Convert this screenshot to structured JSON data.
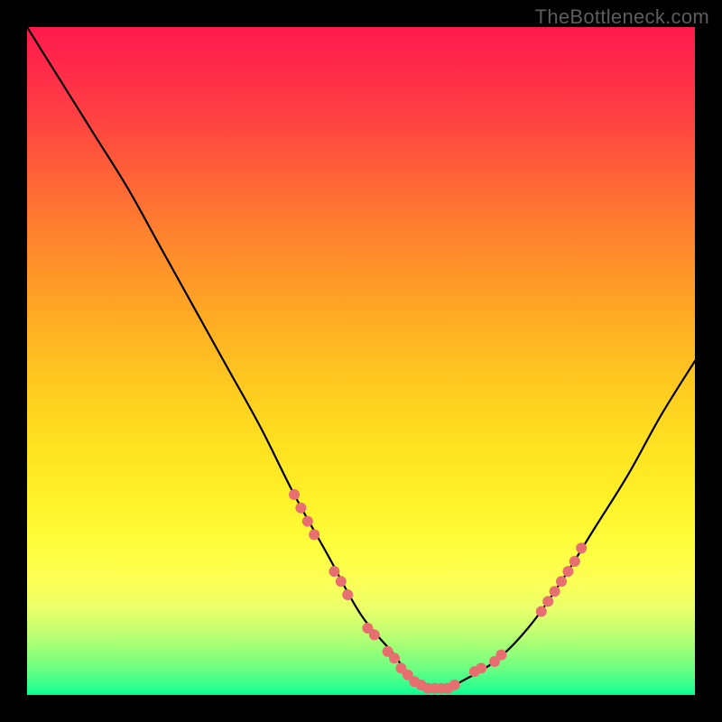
{
  "watermark": "TheBottleneck.com",
  "colors": {
    "curve_stroke": "#000000",
    "marker_fill": "#e86f6f",
    "marker_stroke": "#e86f6f"
  },
  "chart_data": {
    "type": "line",
    "title": "",
    "xlabel": "",
    "ylabel": "",
    "xlim": [
      0,
      100
    ],
    "ylim": [
      0,
      100
    ],
    "grid": false,
    "legend": false,
    "series": [
      {
        "name": "bottleneck-curve",
        "x": [
          0,
          5,
          10,
          15,
          20,
          25,
          30,
          35,
          40,
          45,
          50,
          55,
          57,
          60,
          63,
          65,
          70,
          75,
          80,
          85,
          90,
          95,
          100
        ],
        "y": [
          100,
          92,
          84,
          76,
          67,
          58,
          49,
          40,
          30,
          21,
          12,
          6,
          3,
          1,
          1,
          2,
          5,
          10,
          17,
          25,
          33,
          42,
          50
        ]
      }
    ],
    "markers": [
      {
        "x": 40,
        "y": 30
      },
      {
        "x": 41,
        "y": 28
      },
      {
        "x": 42,
        "y": 26
      },
      {
        "x": 43,
        "y": 24
      },
      {
        "x": 46,
        "y": 18.5
      },
      {
        "x": 47,
        "y": 17
      },
      {
        "x": 48,
        "y": 15
      },
      {
        "x": 51,
        "y": 10
      },
      {
        "x": 52,
        "y": 9
      },
      {
        "x": 54,
        "y": 6.5
      },
      {
        "x": 55,
        "y": 5.5
      },
      {
        "x": 56,
        "y": 4
      },
      {
        "x": 57,
        "y": 3
      },
      {
        "x": 58,
        "y": 2
      },
      {
        "x": 59,
        "y": 1.5
      },
      {
        "x": 60,
        "y": 1
      },
      {
        "x": 61,
        "y": 1
      },
      {
        "x": 62,
        "y": 1
      },
      {
        "x": 63,
        "y": 1
      },
      {
        "x": 64,
        "y": 1.5
      },
      {
        "x": 67,
        "y": 3.5
      },
      {
        "x": 68,
        "y": 4
      },
      {
        "x": 70,
        "y": 5
      },
      {
        "x": 71,
        "y": 6
      },
      {
        "x": 77,
        "y": 12.5
      },
      {
        "x": 78,
        "y": 14
      },
      {
        "x": 79,
        "y": 15.5
      },
      {
        "x": 80,
        "y": 17
      },
      {
        "x": 81,
        "y": 18.5
      },
      {
        "x": 82,
        "y": 20
      },
      {
        "x": 83,
        "y": 22
      }
    ]
  }
}
